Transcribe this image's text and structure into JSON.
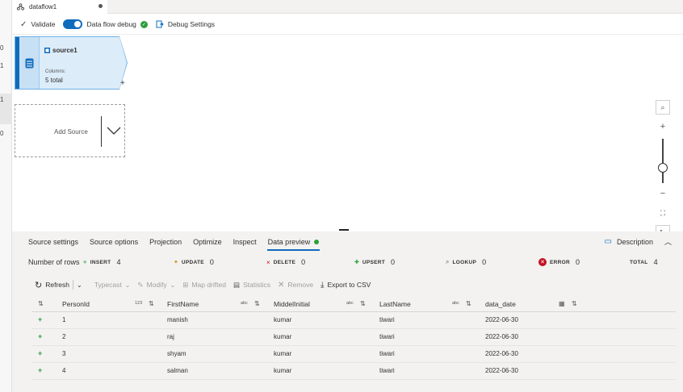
{
  "left_strip": {
    "nums": [
      "0",
      "1",
      "1",
      "0"
    ]
  },
  "tab": {
    "title": "dataflow1"
  },
  "toolbar": {
    "validate": "Validate",
    "debug_label": "Data flow debug",
    "debug_settings": "Debug Settings"
  },
  "canvas": {
    "source": {
      "name": "source1",
      "columns_label": "Columns:",
      "columns_value": "5 total"
    },
    "add_source": "Add Source"
  },
  "panel": {
    "tabs": [
      "Source settings",
      "Source options",
      "Projection",
      "Optimize",
      "Inspect",
      "Data preview"
    ],
    "description": "Description",
    "stats": {
      "rows_label": "Number of rows",
      "insert_label": "INSERT",
      "insert_value": "4",
      "update_label": "UPDATE",
      "update_value": "0",
      "delete_label": "DELETE",
      "delete_value": "0",
      "upsert_label": "UPSERT",
      "upsert_value": "0",
      "lookup_label": "LOOKUP",
      "lookup_value": "0",
      "error_label": "ERROR",
      "error_value": "0",
      "total_label": "TOTAL",
      "total_value": "4"
    },
    "actions": {
      "refresh": "Refresh",
      "typecast": "Typecast",
      "modify": "Modify",
      "map_drifted": "Map drifted",
      "statistics": "Statistics",
      "remove": "Remove",
      "export": "Export to CSV"
    },
    "grid": {
      "columns": [
        {
          "name": "PersonId",
          "type": "123"
        },
        {
          "name": "FirstName",
          "type": "abc"
        },
        {
          "name": "MiddelInitial",
          "type": "abc"
        },
        {
          "name": "LastName",
          "type": "abc"
        },
        {
          "name": "data_date",
          "type": "date"
        }
      ],
      "rows": [
        [
          "1",
          "manish",
          "kumar",
          "tiwari",
          "2022-06-30"
        ],
        [
          "2",
          "raj",
          "kumar",
          "tiwari",
          "2022-06-30"
        ],
        [
          "3",
          "shyam",
          "kumar",
          "tiwari",
          "2022-06-30"
        ],
        [
          "4",
          "salman",
          "kumar",
          "tiwari",
          "2022-06-30"
        ]
      ]
    }
  },
  "colors": {
    "accent": "#0f6cbd",
    "success": "#2e9e3e",
    "error": "#c50f1f"
  }
}
